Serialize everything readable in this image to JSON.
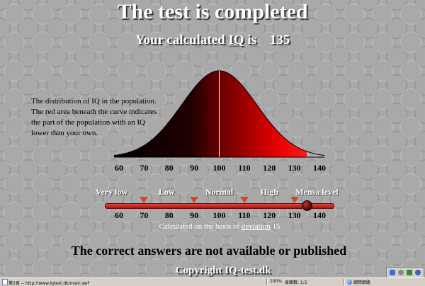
{
  "header": {
    "title": "The test is completed",
    "result_label": "Your calculated",
    "result_abbr": "IQ",
    "result_is": "is",
    "result_value": "135"
  },
  "description": {
    "lines": [
      "The distribution of IQ in the population.",
      "The red area beneath the curve indicates",
      "the part of the population with an IQ",
      "lower than your own."
    ]
  },
  "chart_data": {
    "type": "area",
    "x_ticks": [
      "60",
      "70",
      "80",
      "90",
      "100",
      "110",
      "120",
      "130",
      "140"
    ],
    "xlim": [
      60,
      140
    ],
    "mean": 100,
    "deviation": 15,
    "user_iq": 135,
    "colors": {
      "curve_dark": "#000000",
      "curve_red": "#e00000",
      "median_line": "#ffffff"
    }
  },
  "scale": {
    "categories": [
      "Very low",
      "Low",
      "Normal",
      "High",
      "Mensa level"
    ],
    "category_centers": [
      70,
      90,
      100,
      110,
      130
    ],
    "markers": [
      70,
      90,
      110,
      130
    ],
    "ticks": [
      "60",
      "70",
      "80",
      "90",
      "100",
      "110",
      "120",
      "130",
      "140"
    ],
    "knob_value": 135,
    "basis_prefix": "Calculated on the basis of",
    "basis_link": "deviation",
    "basis_value": "15"
  },
  "footer": {
    "note": "The correct answers are not available or published",
    "copyright": "Copyright IQ-test.dk"
  },
  "statusbar": {
    "page_text": "第2頁 -- http://www.iqtest.dk/main.swf",
    "zoom": "100%",
    "page_count": "頁面數: 1:5",
    "zone": "網際網路"
  }
}
